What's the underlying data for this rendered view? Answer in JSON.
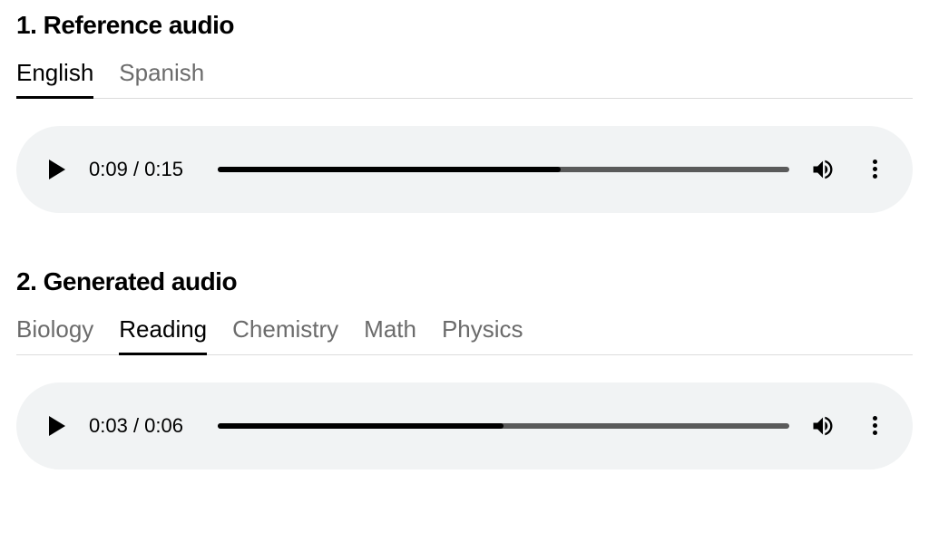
{
  "sections": [
    {
      "title": "1. Reference audio",
      "tabs": [
        {
          "label": "English",
          "active": true
        },
        {
          "label": "Spanish",
          "active": false
        }
      ],
      "player": {
        "current_time": "0:09",
        "total_time": "0:15",
        "progress_percent": 60
      }
    },
    {
      "title": "2. Generated audio",
      "tabs": [
        {
          "label": "Biology",
          "active": false
        },
        {
          "label": "Reading",
          "active": true
        },
        {
          "label": "Chemistry",
          "active": false
        },
        {
          "label": "Math",
          "active": false
        },
        {
          "label": "Physics",
          "active": false
        }
      ],
      "player": {
        "current_time": "0:03",
        "total_time": "0:06",
        "progress_percent": 50
      }
    }
  ]
}
